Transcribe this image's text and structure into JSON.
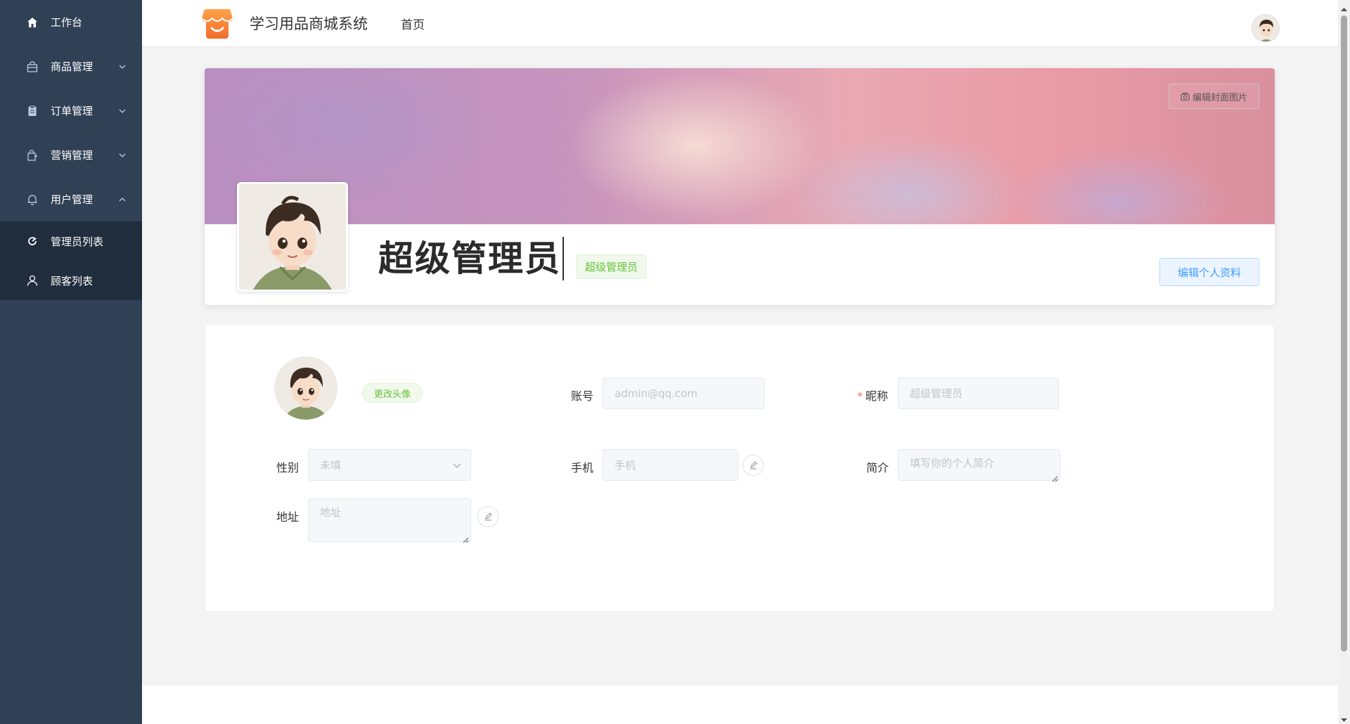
{
  "sidebar": {
    "items": [
      {
        "label": "工作台",
        "icon": "home-icon"
      },
      {
        "label": "商品管理",
        "icon": "bag-icon"
      },
      {
        "label": "订单管理",
        "icon": "clipboard-icon"
      },
      {
        "label": "营销管理",
        "icon": "shopping-bag-icon"
      },
      {
        "label": "用户管理",
        "icon": "bell-icon"
      }
    ],
    "submenu": [
      {
        "label": "管理员列表",
        "icon": "refresh-icon"
      },
      {
        "label": "顾客列表",
        "icon": "user-icon"
      }
    ]
  },
  "header": {
    "title": "学习用品商城系统",
    "home": "首页"
  },
  "profile": {
    "edit_cover": "编辑封面图片",
    "name": "超级管理员",
    "role": "超级管理员",
    "edit_profile": "编辑个人资料"
  },
  "form": {
    "change_avatar": "更改头像",
    "account_label": "账号",
    "account_value": "admin@qq.com",
    "nickname_required": "*",
    "nickname_label": "昵称",
    "nickname_value": "超级管理员",
    "gender_label": "性别",
    "gender_value": "未填",
    "phone_label": "手机",
    "phone_placeholder": "手机",
    "intro_label": "简介",
    "intro_placeholder": "填写你的个人简介",
    "address_label": "地址",
    "address_placeholder": "地址"
  },
  "colors": {
    "sidebar_bg": "#304156",
    "submenu_bg": "#1f2d3d",
    "primary": "#409eff",
    "success": "#67c23a",
    "required": "#f56c6c"
  }
}
